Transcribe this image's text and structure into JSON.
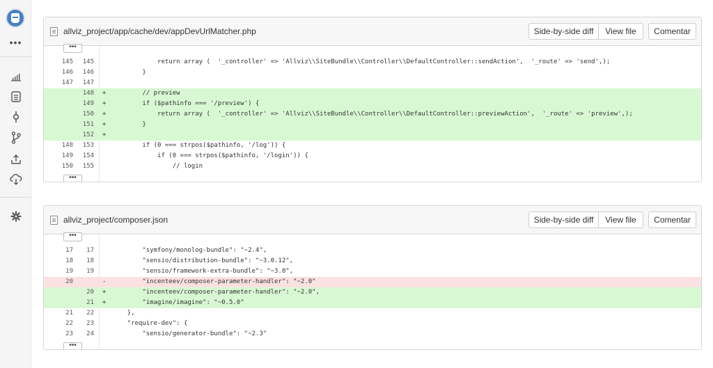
{
  "sidebar": {
    "items": [
      {
        "icon": "more-dots-icon",
        "label": "•••"
      },
      {
        "icon": "stats-icon"
      },
      {
        "icon": "document-icon"
      },
      {
        "icon": "commit-icon"
      },
      {
        "icon": "branch-icon"
      },
      {
        "icon": "upload-icon"
      },
      {
        "icon": "cloud-deploy-icon"
      },
      {
        "icon": "gear-icon"
      }
    ]
  },
  "buttons": {
    "side_by_side": "Side-by-side diff",
    "view_file": "View file",
    "comment": "Comentar",
    "expand": "•••"
  },
  "files": [
    {
      "path": "allviz_project/app/cache/dev/appDevUrlMatcher.php",
      "lines": [
        {
          "old": "145",
          "new": "145",
          "type": "ctx",
          "marker": "",
          "code": "            return array (  '_controller' => 'Allviz\\\\SiteBundle\\\\Controller\\\\DefaultController::sendAction',  '_route' => 'send',);"
        },
        {
          "old": "146",
          "new": "146",
          "type": "ctx",
          "marker": "",
          "code": "        }"
        },
        {
          "old": "147",
          "new": "147",
          "type": "ctx",
          "marker": "",
          "code": ""
        },
        {
          "old": "",
          "new": "148",
          "type": "add",
          "marker": "+",
          "code": "        // preview"
        },
        {
          "old": "",
          "new": "149",
          "type": "add",
          "marker": "+",
          "code": "        if ($pathinfo === '/preview') {"
        },
        {
          "old": "",
          "new": "150",
          "type": "add",
          "marker": "+",
          "code": "            return array (  '_controller' => 'Allviz\\\\SiteBundle\\\\Controller\\\\DefaultController::previewAction',  '_route' => 'preview',);"
        },
        {
          "old": "",
          "new": "151",
          "type": "add",
          "marker": "+",
          "code": "        }"
        },
        {
          "old": "",
          "new": "152",
          "type": "add",
          "marker": "+",
          "code": ""
        },
        {
          "old": "148",
          "new": "153",
          "type": "ctx",
          "marker": "",
          "code": "        if (0 === strpos($pathinfo, '/log')) {"
        },
        {
          "old": "149",
          "new": "154",
          "type": "ctx",
          "marker": "",
          "code": "            if (0 === strpos($pathinfo, '/login')) {"
        },
        {
          "old": "150",
          "new": "155",
          "type": "ctx",
          "marker": "",
          "code": "                // login"
        }
      ]
    },
    {
      "path": "allviz_project/composer.json",
      "lines": [
        {
          "old": "17",
          "new": "17",
          "type": "ctx",
          "marker": "",
          "code": "        \"symfony/monolog-bundle\": \"~2.4\","
        },
        {
          "old": "18",
          "new": "18",
          "type": "ctx",
          "marker": "",
          "code": "        \"sensio/distribution-bundle\": \"~3.0.12\","
        },
        {
          "old": "19",
          "new": "19",
          "type": "ctx",
          "marker": "",
          "code": "        \"sensio/framework-extra-bundle\": \"~3.0\","
        },
        {
          "old": "20",
          "new": "",
          "type": "del",
          "marker": "-",
          "code": "        \"incenteev/composer-parameter-handler\": \"~2.0\""
        },
        {
          "old": "",
          "new": "20",
          "type": "add",
          "marker": "+",
          "code": "        \"incenteev/composer-parameter-handler\": \"~2.0\","
        },
        {
          "old": "",
          "new": "21",
          "type": "add",
          "marker": "+",
          "code": "        \"imagine/imagine\": \"~0.5.0\""
        },
        {
          "old": "21",
          "new": "22",
          "type": "ctx",
          "marker": "",
          "code": "    },"
        },
        {
          "old": "22",
          "new": "23",
          "type": "ctx",
          "marker": "",
          "code": "    \"require-dev\": {"
        },
        {
          "old": "23",
          "new": "24",
          "type": "ctx",
          "marker": "",
          "code": "        \"sensio/generator-bundle\": \"~2.3\""
        }
      ]
    }
  ],
  "colors": {
    "added_line": "#d8f8d3",
    "removed_line": "#fbe1e1",
    "avatar": "#4a7fc1"
  }
}
